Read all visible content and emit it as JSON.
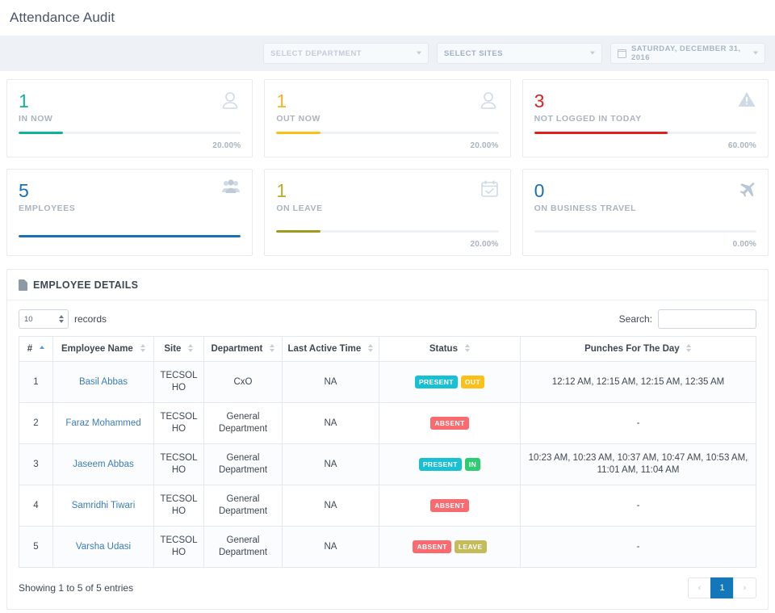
{
  "header": {
    "title": "Attendance Audit"
  },
  "filters": {
    "department": {
      "placeholder": "SELECT DEPARTMENT",
      "value": ""
    },
    "sites": {
      "placeholder": "SELECT SITES",
      "value": ""
    },
    "date": {
      "value": "SATURDAY, DECEMBER 31, 2016",
      "icon": "calendar-icon"
    }
  },
  "cards": [
    {
      "value": "1",
      "label": "IN NOW",
      "pct": "20.00%",
      "fill": 20,
      "color": "#0fb39a",
      "value_color": "#0fb39a",
      "icon": "user-icon",
      "show_pct": true
    },
    {
      "value": "1",
      "label": "OUT NOW",
      "pct": "20.00%",
      "fill": 20,
      "color": "#fcbf18",
      "value_color": "#f0b429",
      "icon": "user-icon",
      "show_pct": true
    },
    {
      "value": "3",
      "label": "NOT LOGGED IN TODAY",
      "pct": "60.00%",
      "fill": 60,
      "color": "#e02020",
      "value_color": "#e02020",
      "icon": "warning-icon",
      "show_pct": true
    },
    {
      "value": "5",
      "label": "EMPLOYEES",
      "pct": "",
      "fill": 100,
      "color": "#1a6fb5",
      "value_color": "#1a6fb5",
      "icon": "users-group-icon",
      "show_pct": false
    },
    {
      "value": "1",
      "label": "ON LEAVE",
      "pct": "20.00%",
      "fill": 20,
      "color": "#9e9b1e",
      "value_color": "#b5ae2a",
      "icon": "calendar-check-icon",
      "show_pct": true
    },
    {
      "value": "0",
      "label": "ON BUSINESS TRAVEL",
      "pct": "0.00%",
      "fill": 0,
      "color": "#1a6fb5",
      "value_color": "#1a6fb5",
      "icon": "airplane-icon",
      "show_pct": true
    }
  ],
  "panel": {
    "title": "EMPLOYEE DETAILS",
    "title_icon": "document-icon",
    "length": {
      "value": "10",
      "suffix_label": "records"
    },
    "search": {
      "label": "Search:",
      "value": "",
      "placeholder": ""
    },
    "columns": [
      {
        "label": "#",
        "sort": "asc"
      },
      {
        "label": "Employee Name",
        "sort": "none"
      },
      {
        "label": "Site",
        "sort": "none"
      },
      {
        "label": "Department",
        "sort": "none"
      },
      {
        "label": "Last Active Time",
        "sort": "none"
      },
      {
        "label": "Status",
        "sort": "none"
      },
      {
        "label": "Punches For The Day",
        "sort": "none"
      }
    ],
    "rows": [
      {
        "num": "1",
        "name": "Basil Abbas",
        "site": "TECSOL HO",
        "department": "CxO",
        "last_active": "NA",
        "status": [
          {
            "text": "PRESENT",
            "color": "#19c0d4"
          },
          {
            "text": "OUT",
            "color": "#fcc018"
          }
        ],
        "punches": "12:12 AM, 12:15 AM, 12:15 AM, 12:35 AM"
      },
      {
        "num": "2",
        "name": "Faraz Mohammed",
        "site": "TECSOL HO",
        "department": "General Department",
        "last_active": "NA",
        "status": [
          {
            "text": "ABSENT",
            "color": "#fa6a6f"
          }
        ],
        "punches": "-"
      },
      {
        "num": "3",
        "name": "Jaseem Abbas",
        "site": "TECSOL HO",
        "department": "General Department",
        "last_active": "NA",
        "status": [
          {
            "text": "PRESENT",
            "color": "#19c0d4"
          },
          {
            "text": "IN",
            "color": "#2ecc71"
          }
        ],
        "punches": "10:23 AM, 10:23 AM, 10:37 AM, 10:47 AM, 10:53 AM, 11:01 AM, 11:04 AM"
      },
      {
        "num": "4",
        "name": "Samridhi Tiwari",
        "site": "TECSOL HO",
        "department": "General Department",
        "last_active": "NA",
        "status": [
          {
            "text": "ABSENT",
            "color": "#fa6a6f"
          }
        ],
        "punches": "-"
      },
      {
        "num": "5",
        "name": "Varsha Udasi",
        "site": "TECSOL HO",
        "department": "General Department",
        "last_active": "NA",
        "status": [
          {
            "text": "ABSENT",
            "color": "#fa6a6f"
          },
          {
            "text": "LEAVE",
            "color": "#c4bb5a"
          }
        ],
        "punches": "-"
      }
    ],
    "footer": {
      "info": "Showing 1 to 5 of 5 entries",
      "pager": {
        "prev": "‹",
        "pages": [
          "1"
        ],
        "next": "›",
        "active": "1"
      }
    }
  }
}
